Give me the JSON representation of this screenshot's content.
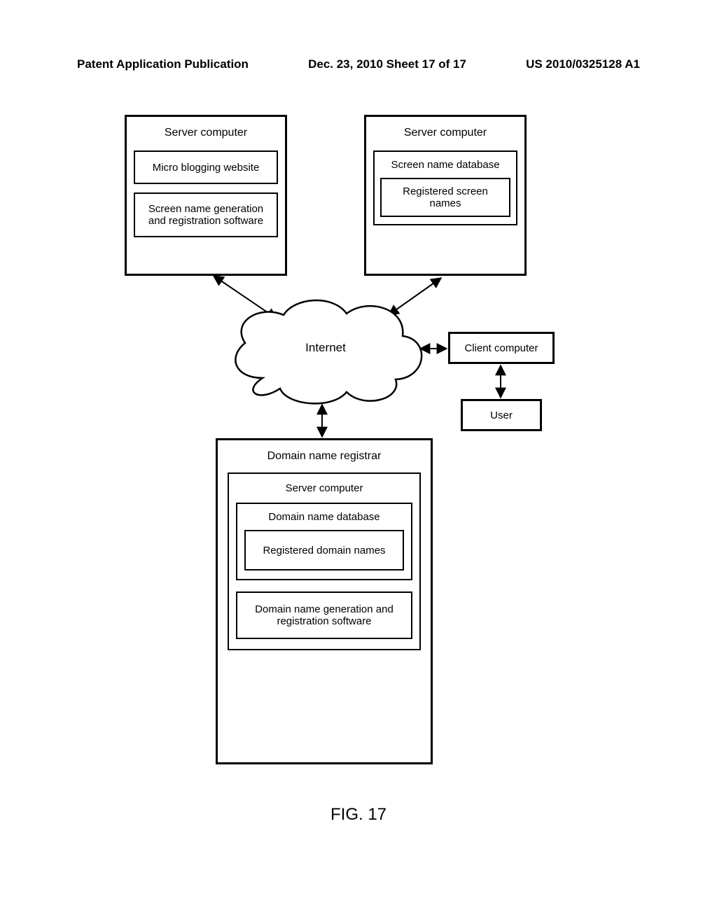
{
  "header": {
    "left": "Patent Application Publication",
    "date": "Dec. 23, 2010  Sheet 17 of 17",
    "right": "US 2010/0325128 A1"
  },
  "serverA": {
    "title": "Server computer",
    "line1": "Micro blogging website",
    "line2": "Screen name generation and registration software"
  },
  "serverB": {
    "title": "Server computer",
    "db": "Screen name database",
    "inner": "Registered screen names"
  },
  "internet": "Internet",
  "client": "Client computer",
  "user": "User",
  "registrar": {
    "title": "Domain name registrar",
    "server": "Server computer",
    "db": "Domain name database",
    "inner": "Registered domain names",
    "sw": "Domain name generation and registration software"
  },
  "figure": "FIG. 17"
}
